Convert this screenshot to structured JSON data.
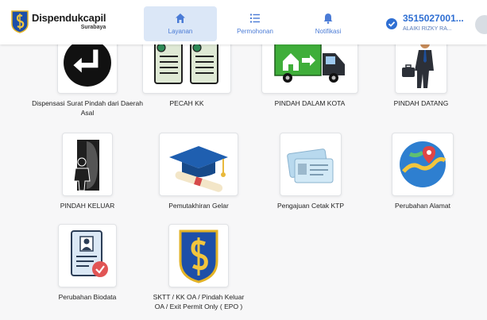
{
  "header": {
    "brand_name": "Dispendukcapil",
    "brand_city": "Surabaya",
    "tabs": [
      {
        "label": "Layanan",
        "icon": "home-icon",
        "active": true
      },
      {
        "label": "Permohonan",
        "icon": "list-icon",
        "active": false
      },
      {
        "label": "Notifikasi",
        "icon": "bell-icon",
        "active": false
      }
    ],
    "profile": {
      "id": "3515027001...",
      "name": "ALAIKI RIZKY RA..."
    }
  },
  "services": [
    {
      "label": "Dispensasi Surat Pindah dari Daerah Asal",
      "icon": "return-arrow-icon"
    },
    {
      "label": "PECAH KK",
      "icon": "split-documents-icon"
    },
    {
      "label": "PINDAH DALAM KOTA",
      "icon": "moving-truck-icon"
    },
    {
      "label": "PINDAH DATANG",
      "icon": "businessman-arriving-icon"
    },
    {
      "label": "PINDAH KELUAR",
      "icon": "person-exit-door-icon"
    },
    {
      "label": "Pemutakhiran Gelar",
      "icon": "graduation-cap-icon"
    },
    {
      "label": "Pengajuan Cetak KTP",
      "icon": "id-cards-icon"
    },
    {
      "label": "Perubahan Alamat",
      "icon": "map-location-icon"
    },
    {
      "label": "Perubahan Biodata",
      "icon": "biodata-document-icon"
    },
    {
      "label": "SKTT / KK OA / Pindah Keluar OA / Exit Permit Only ( EPO )",
      "icon": "surabaya-emblem-icon"
    }
  ],
  "colors": {
    "accent": "#2f6fd3",
    "active_tab_bg": "#dbe7f7",
    "page_bg": "#f7f7f8"
  }
}
